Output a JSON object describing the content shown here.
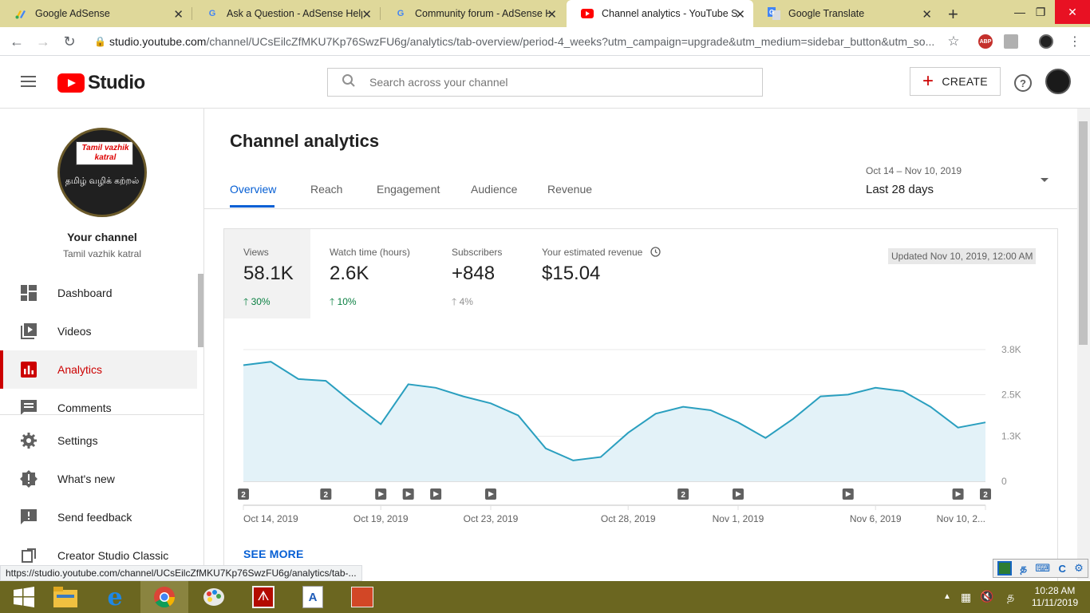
{
  "browser": {
    "tabs": [
      {
        "title": "Google AdSense",
        "favicon": "adsense-icon"
      },
      {
        "title": "Ask a Question - AdSense Help",
        "favicon": "google-icon"
      },
      {
        "title": "Community forum - AdSense He",
        "favicon": "google-icon"
      },
      {
        "title": "Channel analytics - YouTube Stu",
        "favicon": "youtube-icon",
        "active": true
      },
      {
        "title": "Google Translate",
        "favicon": "translate-icon"
      }
    ],
    "url_host": "studio.youtube.com",
    "url_path": "/channel/UCsEilcZfMKU7Kp76SwzFU6g/analytics/tab-overview/period-4_weeks?utm_campaign=upgrade&utm_medium=sidebar_button&utm_so...",
    "extensions": [
      "ABP"
    ],
    "status_url": "https://studio.youtube.com/channel/UCsEilcZfMKU7Kp76SwzFU6g/analytics/tab-..."
  },
  "header": {
    "logo_text": "Studio",
    "search_placeholder": "Search across your channel",
    "create_label": "CREATE",
    "help_label": "?"
  },
  "sidebar": {
    "avatar_text_top": "Tamil vazhik katral",
    "avatar_text_bottom": "தமிழ் வழிக் கற்றல்",
    "channel_label": "Your channel",
    "channel_name": "Tamil vazhik katral",
    "items": [
      {
        "label": "Dashboard",
        "icon": "dashboard-icon"
      },
      {
        "label": "Videos",
        "icon": "videos-icon"
      },
      {
        "label": "Analytics",
        "icon": "analytics-icon",
        "active": true
      },
      {
        "label": "Comments",
        "icon": "comments-icon"
      },
      {
        "label": "Settings",
        "icon": "settings-icon"
      },
      {
        "label": "What's new",
        "icon": "whats-new-icon"
      },
      {
        "label": "Send feedback",
        "icon": "feedback-icon"
      },
      {
        "label": "Creator Studio Classic",
        "icon": "classic-icon"
      }
    ]
  },
  "main": {
    "title": "Channel analytics",
    "tabs": [
      "Overview",
      "Reach",
      "Engagement",
      "Audience",
      "Revenue"
    ],
    "date_range": "Oct 14 – Nov 10, 2019",
    "period": "Last 28 days",
    "updated": "Updated Nov 10, 2019, 12:00 AM",
    "see_more": "SEE MORE",
    "metrics": [
      {
        "label": "Views",
        "value": "58.1K",
        "change": "30%",
        "trend": "up",
        "color": "#0b8043"
      },
      {
        "label": "Watch time (hours)",
        "value": "2.6K",
        "change": "10%",
        "trend": "up",
        "color": "#0b8043"
      },
      {
        "label": "Subscribers",
        "value": "+848",
        "change": "4%",
        "trend": "up",
        "color": "#909090"
      },
      {
        "label": "Your estimated revenue",
        "value": "$15.04",
        "change": "",
        "trend": "",
        "color": ""
      }
    ]
  },
  "chart_data": {
    "type": "area",
    "x": [
      "Oct 14",
      "Oct 15",
      "Oct 16",
      "Oct 17",
      "Oct 18",
      "Oct 19",
      "Oct 20",
      "Oct 21",
      "Oct 22",
      "Oct 23",
      "Oct 24",
      "Oct 25",
      "Oct 26",
      "Oct 27",
      "Oct 28",
      "Oct 29",
      "Oct 30",
      "Oct 31",
      "Nov 1",
      "Nov 2",
      "Nov 3",
      "Nov 4",
      "Nov 5",
      "Nov 6",
      "Nov 7",
      "Nov 8",
      "Nov 9",
      "Nov 10"
    ],
    "values": [
      3350,
      3450,
      2950,
      2900,
      2250,
      1650,
      2800,
      2700,
      2450,
      2250,
      1900,
      950,
      600,
      700,
      1400,
      1950,
      2150,
      2050,
      1700,
      1250,
      1800,
      2450,
      2500,
      2700,
      2600,
      2150,
      1550,
      1700
    ],
    "xtick_labels": [
      "Oct 14, 2019",
      "Oct 19, 2019",
      "Oct 23, 2019",
      "Oct 28, 2019",
      "Nov 1, 2019",
      "Nov 6, 2019",
      "Nov 10, 2..."
    ],
    "xtick_index": [
      0,
      5,
      9,
      14,
      18,
      23,
      27
    ],
    "ytick_labels": [
      "3.8K",
      "2.5K",
      "1.3K",
      "0"
    ],
    "ytick_values": [
      3800,
      2500,
      1300,
      0
    ],
    "ylim": [
      0,
      3800
    ],
    "grid": true,
    "line_color": "#2a9fbf",
    "fill_color": "#e3f2f8",
    "markers": [
      {
        "index": 0,
        "kind": "count",
        "label": "2"
      },
      {
        "index": 3,
        "kind": "count",
        "label": "2"
      },
      {
        "index": 5,
        "kind": "video",
        "label": ""
      },
      {
        "index": 6,
        "kind": "video",
        "label": ""
      },
      {
        "index": 7,
        "kind": "video",
        "label": ""
      },
      {
        "index": 9,
        "kind": "video",
        "label": ""
      },
      {
        "index": 16,
        "kind": "count",
        "label": "2"
      },
      {
        "index": 18,
        "kind": "video",
        "label": ""
      },
      {
        "index": 22,
        "kind": "video",
        "label": ""
      },
      {
        "index": 26,
        "kind": "video",
        "label": ""
      },
      {
        "index": 27,
        "kind": "count",
        "label": "2"
      }
    ]
  },
  "taskbar": {
    "time": "10:28 AM",
    "date": "11/11/2019",
    "apps": [
      "start-icon",
      "file-explorer-icon",
      "internet-explorer-icon",
      "chrome-icon",
      "paint-icon",
      "acrobat-icon",
      "word-icon",
      "powerpoint-icon"
    ]
  }
}
